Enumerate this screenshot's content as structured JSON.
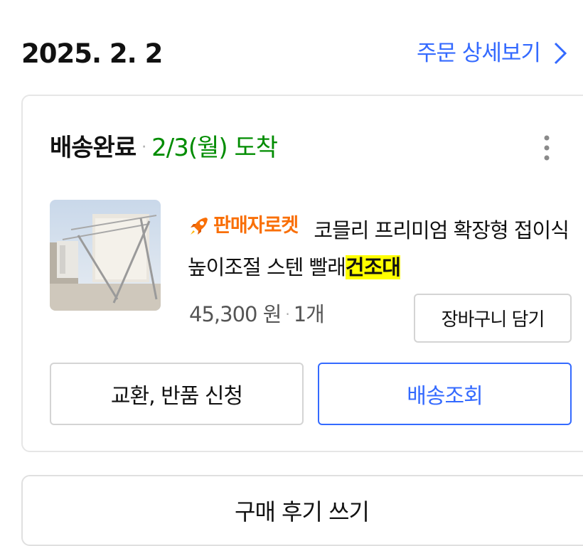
{
  "order": {
    "date": "2025. 2. 2",
    "detail_link": "주문 상세보기"
  },
  "shipment": {
    "status": "배송완료",
    "arrival": "2/3(월) 도착"
  },
  "product": {
    "badge": "판매자로켓",
    "title_main": "코믈리 프리미엄 확장형 접이식 높이조절 스텐 빨래",
    "title_highlight": "건조대",
    "price": "45,300 원",
    "quantity": "1개"
  },
  "buttons": {
    "add_to_cart": "장바구니 담기",
    "exchange_return": "교환, 반품 신청",
    "track_delivery": "배송조회",
    "write_review": "구매 후기 쓰기"
  },
  "colors": {
    "accent_blue": "#346aff",
    "delivered_green": "#008c00",
    "rocket_orange": "#f96f07",
    "highlight_yellow": "#ffff00"
  },
  "icons": {
    "detail_chevron": "chevron-right-icon",
    "more": "more-vertical-icon",
    "badge": "rocket-icon"
  }
}
